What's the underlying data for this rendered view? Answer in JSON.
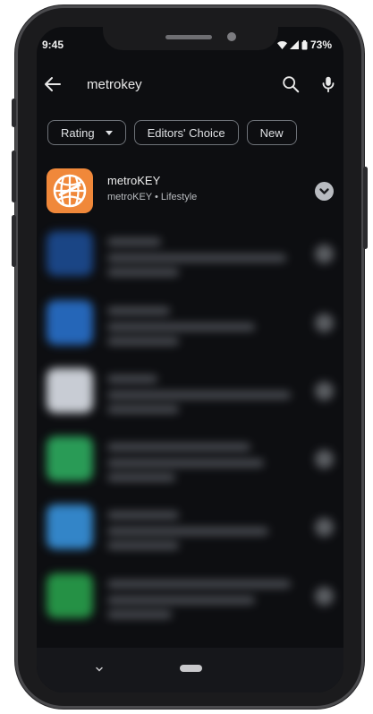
{
  "status_bar": {
    "time": "9:45",
    "battery": "73%"
  },
  "search": {
    "query": "metrokey"
  },
  "filters": [
    {
      "label": "Rating",
      "has_dropdown": true
    },
    {
      "label": "Editors' Choice",
      "has_dropdown": false
    },
    {
      "label": "New",
      "has_dropdown": false
    }
  ],
  "results": [
    {
      "title": "metroKEY",
      "developer": "metroKEY",
      "category": "Lifestyle",
      "separator": "•",
      "icon": "globe-grid-icon",
      "icon_color": "#f0883a"
    }
  ],
  "blurred_icon_colors": [
    "#1d4f9a",
    "#2a76d6",
    "#e9eef6",
    "#2fb463",
    "#3a9ae8",
    "#2aa84f"
  ],
  "colors": {
    "background": "#0d0e11",
    "chip_border": "#6e7278",
    "nav_bar": "#16171b"
  }
}
